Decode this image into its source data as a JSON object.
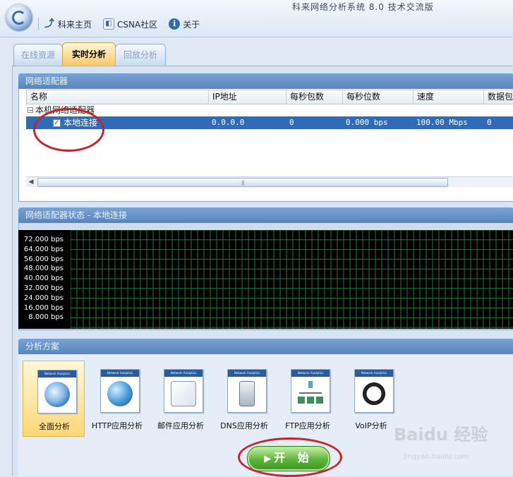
{
  "app": {
    "title": "科来网络分析系统 8.0 技术交流版"
  },
  "nav": [
    {
      "icon": "home-icon",
      "label": "科来主页"
    },
    {
      "icon": "community-icon",
      "label": "CSNA社区"
    },
    {
      "icon": "info-icon",
      "label": "关于"
    }
  ],
  "tabs": [
    {
      "label": "在线资源",
      "active": false
    },
    {
      "label": "实时分析",
      "active": true
    },
    {
      "label": "回放分析",
      "active": false
    }
  ],
  "adapter_panel": {
    "title": "网络适配器",
    "columns": [
      "名称",
      "IP地址",
      "每秒包数",
      "每秒位数",
      "速度",
      "数据包"
    ],
    "group": "本机网络适配器",
    "rows": [
      {
        "name": "本地连接",
        "checked": true,
        "ip": "0.0.0.0",
        "pps": "0",
        "bps": "0.000 bps",
        "speed": "100.00 Mbps",
        "packets": "0"
      }
    ]
  },
  "status_panel": {
    "title": "网络适配器状态 - 本地连接",
    "y_ticks": [
      "72.000 bps",
      "64.000 bps",
      "56.000 bps",
      "48.000 bps",
      "40.000 bps",
      "32.000 bps",
      "24.000 bps",
      "16.000 bps",
      "8.000 bps"
    ]
  },
  "scheme_panel": {
    "title": "分析方案",
    "tools": [
      {
        "label": "全面分析",
        "icon": "magnifier-icon",
        "active": true
      },
      {
        "label": "HTTP应用分析",
        "icon": "globe-icon",
        "active": false
      },
      {
        "label": "邮件应用分析",
        "icon": "mail-icon",
        "active": false
      },
      {
        "label": "DNS应用分析",
        "icon": "server-icon",
        "active": false
      },
      {
        "label": "FTP应用分析",
        "icon": "network-tree-icon",
        "active": false
      },
      {
        "label": "VoIP分析",
        "icon": "headset-icon",
        "active": false
      }
    ],
    "tool_badge": "Network Analytics"
  },
  "start_button": {
    "label": "开 始"
  },
  "watermark": {
    "brand": "Baidu 经验",
    "url": "jingyan.baidu.com"
  },
  "colors": {
    "selection": "#2f6cb7",
    "highlight_circle": "#c8232c",
    "start_green": "#5cb43a",
    "grid_green": "#1f7a3a"
  }
}
